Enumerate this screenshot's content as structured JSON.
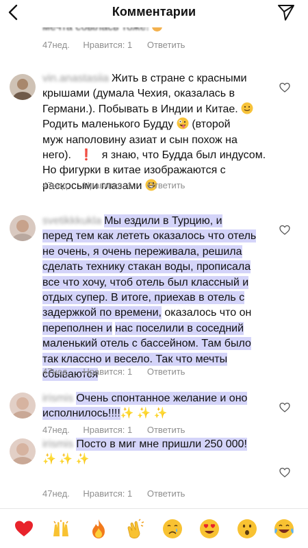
{
  "header": {
    "title": "Комментарии",
    "back_icon": "chevron-left-icon",
    "send_icon": "paper-plane-icon"
  },
  "cut_comment": {
    "text": "мечта сбылась тоже!",
    "meta": {
      "age": "47нед.",
      "likes": "Нравится: 1",
      "reply": "Ответить"
    }
  },
  "comments": [
    {
      "username": "vin.anastasiia",
      "lines": [
        "Жить в стране с красными",
        "крышами (думала Чехия, оказалась в",
        "Германи.). Побывать в Индии и Китае.",
        "Родить маленького Будду",
        "(второй",
        "муж наполовину азиат и сын похож на",
        "него).",
        "я знаю, что Будда был индусом.",
        "Но фигурки в китае изображаются с",
        "раскосыми глазами"
      ],
      "meta": {
        "age": "47нед.",
        "likes": "Нравится: 1",
        "reply": "Ответить"
      }
    },
    {
      "username": "svetikkkukla",
      "lines": [
        "Мы ездили в Турцию, и",
        "перед тем как лететь оказалось что отель",
        "не очень, я очень переживала, решила",
        "сделать технику стакан воды, прописала",
        "все что хочу, чтоб отель был классный и",
        "отдых супер. В итоге, приехав в отель с",
        "задержкой по времени,",
        "оказалось что он",
        "переполнен и",
        "нас поселили в соседний",
        "маленький отель с бассейном. Там было",
        "так классно и весело. Так что мечты",
        "сбываются"
      ],
      "meta": {
        "age": "47нед.",
        "likes": "Нравится: 1",
        "reply": "Ответить"
      }
    },
    {
      "username": "irismis",
      "lines": [
        "Очень спонтанное желание и оно",
        "исполнилось!!!!"
      ],
      "meta": {
        "age": "47нед.",
        "likes": "Нравится: 1",
        "reply": "Ответить"
      }
    },
    {
      "username": "irismis",
      "lines": [
        "Посто в миг мне пришли 250 000!"
      ],
      "meta": {
        "age": "47нед.",
        "likes": "Нравится: 1",
        "reply": "Ответить"
      }
    }
  ],
  "emoji_bar": [
    "red-heart-icon",
    "raising-hands-icon",
    "fire-icon",
    "clapping-hands-icon",
    "crying-face-icon",
    "heart-eyes-face-icon",
    "astonished-face-icon",
    "tears-of-joy-face-icon"
  ],
  "colors": {
    "highlight": "#d4d4f9",
    "meta_text": "#8e8e8e",
    "username": "#b9b9b9"
  }
}
